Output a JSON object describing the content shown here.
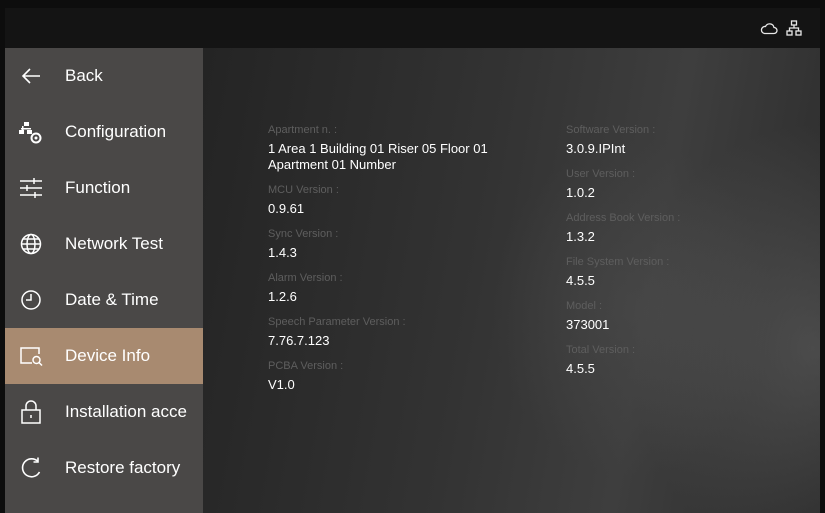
{
  "status_bar": {
    "icons": [
      "cloud-icon",
      "network-icon"
    ]
  },
  "sidebar": {
    "items": [
      {
        "label": "Back",
        "icon": "back-arrow-icon",
        "active": false
      },
      {
        "label": "Configuration",
        "icon": "configuration-icon",
        "active": false
      },
      {
        "label": "Function",
        "icon": "function-sliders-icon",
        "active": false
      },
      {
        "label": "Network Test",
        "icon": "globe-icon",
        "active": false
      },
      {
        "label": "Date & Time",
        "icon": "clock-icon",
        "active": false
      },
      {
        "label": "Device Info",
        "icon": "device-info-icon",
        "active": true
      },
      {
        "label": "Installation acce",
        "icon": "lock-icon",
        "active": false
      },
      {
        "label": "Restore factory",
        "icon": "restore-icon",
        "active": false
      }
    ]
  },
  "device_info": {
    "left": [
      {
        "label": "Apartment n. :",
        "value": "1 Area 1 Building 01 Riser 05 Floor 01 Apartment 01 Number"
      },
      {
        "label": "MCU Version :",
        "value": "0.9.61"
      },
      {
        "label": "Sync Version :",
        "value": "1.4.3"
      },
      {
        "label": "Alarm Version :",
        "value": "1.2.6"
      },
      {
        "label": "Speech Parameter Version :",
        "value": "7.76.7.123"
      },
      {
        "label": "PCBA Version :",
        "value": "V1.0"
      }
    ],
    "right": [
      {
        "label": "Software Version :",
        "value": "3.0.9.IPInt"
      },
      {
        "label": "User Version :",
        "value": "1.0.2"
      },
      {
        "label": "Address Book Version :",
        "value": "1.3.2"
      },
      {
        "label": "File System Version :",
        "value": "4.5.5"
      },
      {
        "label": "Model :",
        "value": "373001"
      },
      {
        "label": "Total Version :",
        "value": "4.5.5"
      }
    ]
  },
  "colors": {
    "sidebar_bg": "#4a4847",
    "active_item": "#a88a70",
    "label_text": "#5e5e5e",
    "value_text": "#ffffff"
  }
}
